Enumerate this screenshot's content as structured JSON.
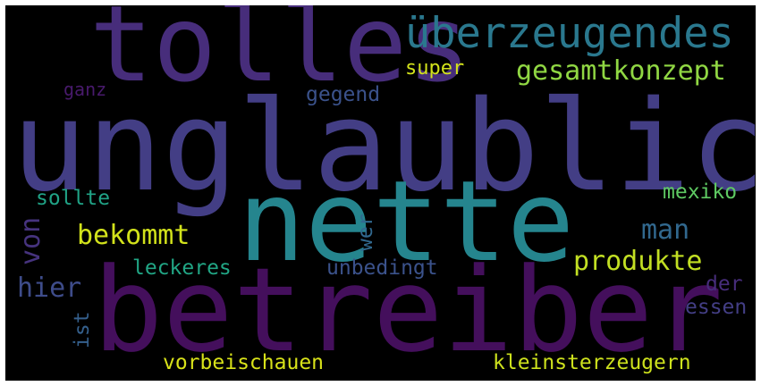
{
  "background": "#000000",
  "words": [
    {
      "text": "unglaublich",
      "color": "#433e85"
    },
    {
      "text": "betreiber",
      "color": "#440f5c"
    },
    {
      "text": "nette",
      "color": "#25858e"
    },
    {
      "text": "tolles",
      "color": "#472d7b"
    },
    {
      "text": "überzeugendes",
      "color": "#2a788e"
    },
    {
      "text": "gesamtkonzept",
      "color": "#90d743"
    },
    {
      "text": "super",
      "color": "#d2e21b"
    },
    {
      "text": "ganz",
      "color": "#481a6c"
    },
    {
      "text": "gegend",
      "color": "#3b528b"
    },
    {
      "text": "sollte",
      "color": "#20a386"
    },
    {
      "text": "von",
      "color": "#46337e"
    },
    {
      "text": "bekommt",
      "color": "#d2e21b"
    },
    {
      "text": "wer",
      "color": "#31688e"
    },
    {
      "text": "man",
      "color": "#31688e"
    },
    {
      "text": "mexiko",
      "color": "#5ec962"
    },
    {
      "text": "produkte",
      "color": "#c2df23"
    },
    {
      "text": "hier",
      "color": "#3e4c8a"
    },
    {
      "text": "leckeres",
      "color": "#21a685"
    },
    {
      "text": "unbedingt",
      "color": "#3b528b"
    },
    {
      "text": "der",
      "color": "#472d7b"
    },
    {
      "text": "essen",
      "color": "#433e85"
    },
    {
      "text": "ist",
      "color": "#35608d"
    },
    {
      "text": "vorbeischauen",
      "color": "#d8e219"
    },
    {
      "text": "kleinsterzeugern",
      "color": "#cde11d"
    }
  ]
}
